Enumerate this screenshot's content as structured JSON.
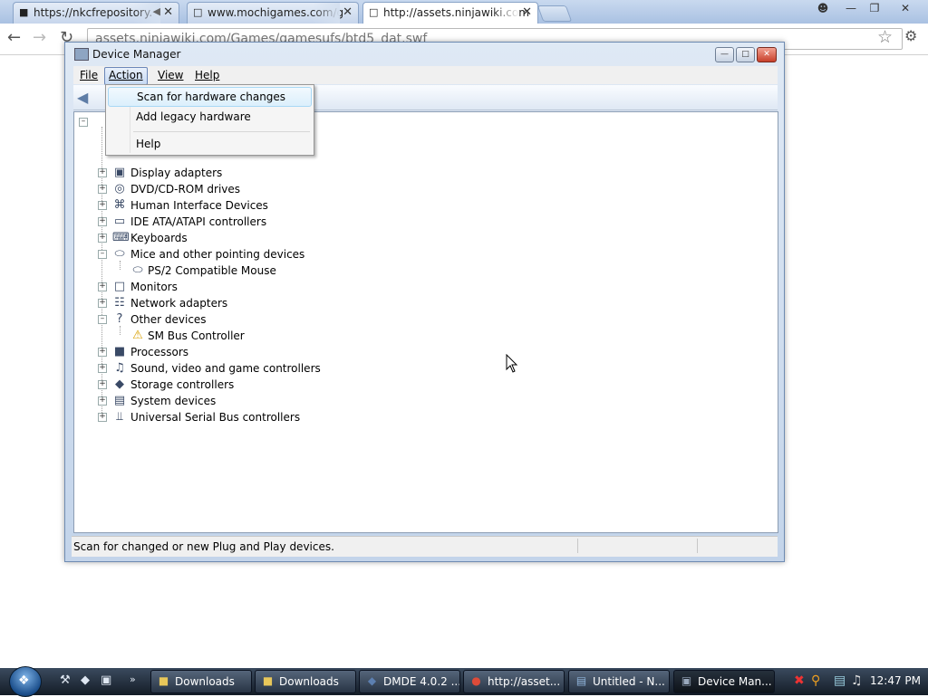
{
  "browser": {
    "tabs": [
      {
        "title": "https://nkcfrepository.",
        "icon": "folder-icon"
      },
      {
        "title": "www.mochigames.com/g",
        "icon": "page-icon"
      },
      {
        "title": "http://assets.ninjawiki.com",
        "icon": "page-icon",
        "active": true
      }
    ],
    "address": "assets.ninjawiki.com/Games/gamesufs/btd5_dat.swf"
  },
  "window": {
    "title": "Device Manager",
    "menus": [
      "File",
      "Action",
      "View",
      "Help"
    ],
    "open_menu": "Action",
    "action_menu": [
      "Scan for hardware changes",
      "Add legacy hardware",
      "Help"
    ],
    "status": "Scan for changed or new Plug and Play devices."
  },
  "tree": [
    {
      "label": "Display adapters",
      "state": "collapsed",
      "icon": "display-adapter-icon"
    },
    {
      "label": "DVD/CD-ROM drives",
      "state": "collapsed",
      "icon": "dvd-drive-icon"
    },
    {
      "label": "Human Interface Devices",
      "state": "collapsed",
      "icon": "hid-icon"
    },
    {
      "label": "IDE ATA/ATAPI controllers",
      "state": "collapsed",
      "icon": "ide-controller-icon"
    },
    {
      "label": "Keyboards",
      "state": "collapsed",
      "icon": "keyboard-icon"
    },
    {
      "label": "Mice and other pointing devices",
      "state": "expanded",
      "icon": "mouse-icon"
    },
    {
      "label": "PS/2 Compatible Mouse",
      "state": "child",
      "icon": "mouse-icon"
    },
    {
      "label": "Monitors",
      "state": "collapsed",
      "icon": "monitor-icon"
    },
    {
      "label": "Network adapters",
      "state": "collapsed",
      "icon": "network-icon"
    },
    {
      "label": "Other devices",
      "state": "expanded",
      "icon": "other-device-icon"
    },
    {
      "label": "SM Bus Controller",
      "state": "child",
      "icon": "warning-device-icon"
    },
    {
      "label": "Processors",
      "state": "collapsed",
      "icon": "processor-icon"
    },
    {
      "label": "Sound, video and game controllers",
      "state": "collapsed",
      "icon": "sound-icon"
    },
    {
      "label": "Storage controllers",
      "state": "collapsed",
      "icon": "storage-icon"
    },
    {
      "label": "System devices",
      "state": "collapsed",
      "icon": "system-icon"
    },
    {
      "label": "Universal Serial Bus controllers",
      "state": "collapsed",
      "icon": "usb-icon"
    }
  ],
  "taskbar": {
    "buttons": [
      {
        "label": "Downloads",
        "icon": "folder-icon"
      },
      {
        "label": "Downloads",
        "icon": "folder-icon"
      },
      {
        "label": "DMDE 4.0.2 ...",
        "icon": "dmde-icon"
      },
      {
        "label": "http://asset...",
        "icon": "chrome-icon"
      },
      {
        "label": "Untitled - N...",
        "icon": "notepad-icon"
      },
      {
        "label": "Device Man...",
        "icon": "device-manager-icon",
        "active": true
      }
    ],
    "clock": "12:47 PM"
  },
  "colors": {
    "accent": "#3399ff",
    "titlebar": "#c3d4ea",
    "taskbar": "#1f2a38"
  }
}
